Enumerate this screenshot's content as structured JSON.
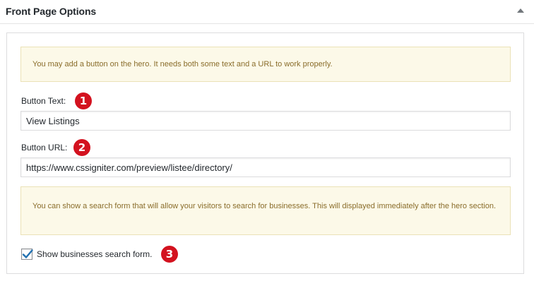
{
  "metabox": {
    "title": "Front Page Options",
    "toggle_icon": "triangle-up-icon"
  },
  "notices": {
    "button_notice": "You may add a button on the hero. It needs both some text and a URL to work properly.",
    "search_notice": "You can show a search form that will allow your visitors to search for businesses. This will displayed immediately after the hero section."
  },
  "fields": {
    "button_text": {
      "label": "Button Text:",
      "value": "View Listings"
    },
    "button_url": {
      "label": "Button URL:",
      "value": "https://www.cssigniter.com/preview/listee/directory/"
    },
    "show_search": {
      "label": "Show businesses search form.",
      "checked": true
    }
  },
  "annotations": [
    "1",
    "2",
    "3"
  ],
  "colors": {
    "annotation_badge": "#d3121f",
    "notice_bg": "#fcf9e8",
    "notice_text": "#8a6d2b",
    "checkmark": "#2271b1"
  }
}
